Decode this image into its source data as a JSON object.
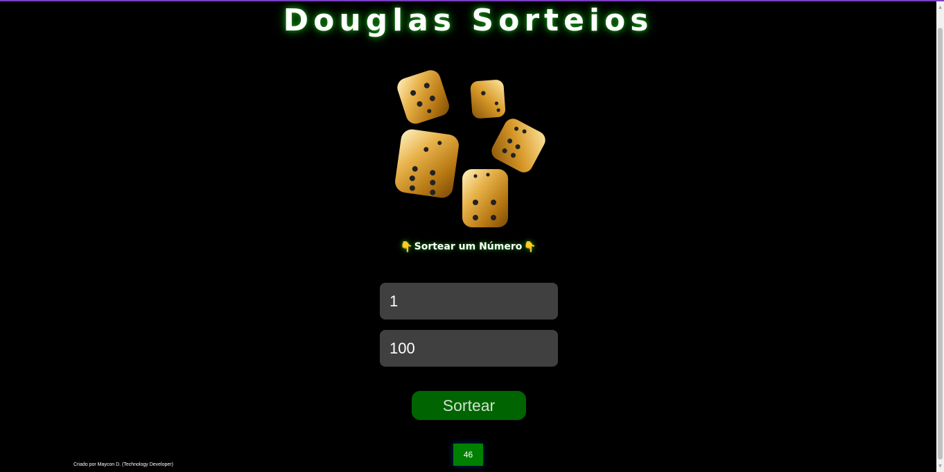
{
  "page": {
    "title": "Douglas Sorteios",
    "subtitle": "Sortear um Número",
    "subtitle_icon_left": "👇",
    "subtitle_icon_right": "👇",
    "image": {
      "icon": "golden-dice",
      "count": 5
    }
  },
  "form": {
    "min_value": "1",
    "max_value": "100",
    "button_label": "Sortear"
  },
  "result": {
    "value": "46"
  },
  "footer": {
    "credit": "Criado por Maycon D. (Technology Developer)"
  },
  "colors": {
    "background": "#000000",
    "title_glow": "#1b8a1b",
    "input_bg": "#404040",
    "button_bg": "#006400",
    "result_bg": "#008000",
    "top_border": "#7b3fc4"
  }
}
